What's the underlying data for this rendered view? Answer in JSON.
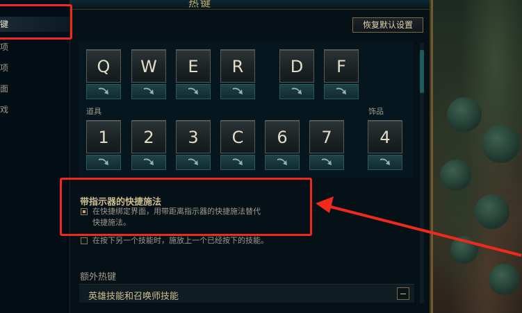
{
  "window": {
    "title": "热键"
  },
  "sidebar": {
    "items": [
      {
        "label": "键"
      },
      {
        "label": "项"
      },
      {
        "label": "项"
      },
      {
        "label": "面"
      },
      {
        "label": "戏"
      }
    ]
  },
  "toolbar": {
    "reset_label": "恢复默认设置"
  },
  "keys": {
    "top_row": [
      "Q",
      "W",
      "E",
      "R",
      "D",
      "F"
    ],
    "items_label": "道具",
    "item_keys": [
      "1",
      "2",
      "3",
      "C",
      "6",
      "7"
    ],
    "trinket_label": "饰品",
    "trinket_key": "4"
  },
  "quickcast": {
    "title": "带指示器的快捷施法",
    "checked": true,
    "description_line1": "在快捷绑定界面，用带距离指示器的快捷施法替代",
    "description_line2": "快捷施法。"
  },
  "option2": {
    "checked": false,
    "text": "在按下另一个技能时，施放上一个已经按下的技能。"
  },
  "extra": {
    "title": "额外热键",
    "section_label": "英雄技能和召唤师技能"
  },
  "colors": {
    "accent_gold": "#c8aa6e",
    "annotation_red": "#f0291c"
  }
}
